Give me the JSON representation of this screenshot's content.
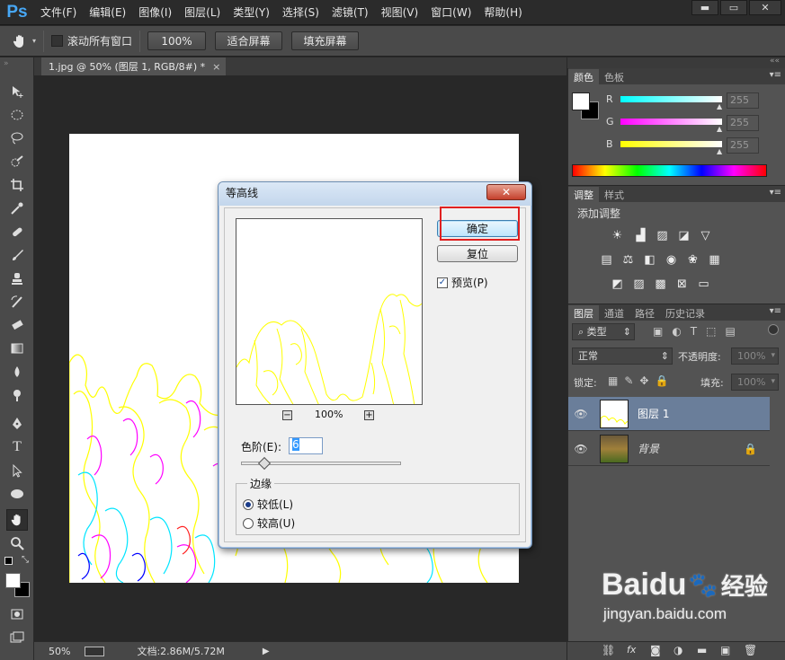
{
  "app": {
    "logo": "Ps"
  },
  "menu": [
    "文件(F)",
    "编辑(E)",
    "图像(I)",
    "图层(L)",
    "类型(Y)",
    "选择(S)",
    "滤镜(T)",
    "视图(V)",
    "窗口(W)",
    "帮助(H)"
  ],
  "window_buttons": {
    "minimize": "▬",
    "restore": "▭",
    "close": "✕"
  },
  "options": {
    "scroll_all_label": "滚动所有窗口",
    "zoom_100": "100%",
    "fit_screen": "适合屏幕",
    "fill_screen": "填充屏幕"
  },
  "document": {
    "tab_title": "1.jpg @ 50% (图层 1, RGB/8#) *",
    "tab_close": "×"
  },
  "status": {
    "zoom": "50%",
    "doc_size": "文档:2.86M/5.72M"
  },
  "color_panel": {
    "tabs": [
      "颜色",
      "色板"
    ],
    "channels": [
      {
        "label": "R",
        "value": "255",
        "color": "#00ffff"
      },
      {
        "label": "G",
        "value": "255",
        "color": "#ff00ff"
      },
      {
        "label": "B",
        "value": "255",
        "color": "#ffff00"
      }
    ]
  },
  "adjust_panel": {
    "tabs": [
      "调整",
      "样式"
    ],
    "title": "添加调整"
  },
  "layers_panel": {
    "tabs": [
      "图层",
      "通道",
      "路径",
      "历史记录"
    ],
    "filter_kind": "类型",
    "blend_mode": "正常",
    "opacity_label": "不透明度:",
    "opacity_value": "100%",
    "lock_label": "锁定:",
    "fill_label": "填充:",
    "fill_value": "100%",
    "layers": [
      {
        "name": "图层 1",
        "selected": true
      },
      {
        "name": "背景",
        "selected": false,
        "locked": true
      }
    ]
  },
  "dialog": {
    "title": "等高线",
    "close": "✕",
    "ok": "确定",
    "reset": "复位",
    "preview_label": "预览(P)",
    "preview_checked": true,
    "zoom_minus": "−",
    "zoom_level": "100%",
    "zoom_plus": "+",
    "level_label": "色阶(E):",
    "level_value": "6",
    "level_fraction": 0.05,
    "edge_group": "边缘",
    "edge_low": "较低(L)",
    "edge_high": "较高(U)",
    "edge_selected": "low"
  },
  "watermark": {
    "brand": "Baidu",
    "brand_cn": "经验",
    "url": "jingyan.baidu.com"
  },
  "colors": {
    "accent_red": "#e02020",
    "ps_blue": "#47a7f5"
  }
}
